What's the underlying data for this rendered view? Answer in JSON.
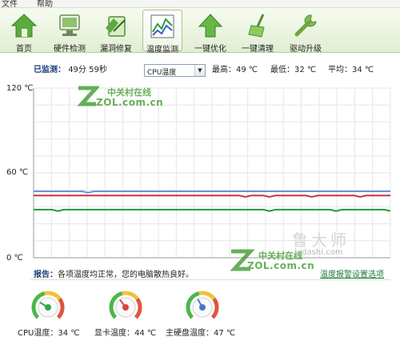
{
  "menu": {
    "file": "文件",
    "help": "帮助"
  },
  "toolbar": [
    {
      "label": "首页",
      "icon": "home-icon"
    },
    {
      "label": "硬件检测",
      "icon": "hardware-detect-icon"
    },
    {
      "label": "漏洞修复",
      "icon": "vulnerability-fix-icon"
    },
    {
      "label": "温度监测",
      "icon": "temperature-monitor-icon",
      "active": true
    },
    {
      "label": "一键优化",
      "icon": "optimize-arrow-icon"
    },
    {
      "label": "一键清理",
      "icon": "broom-icon"
    },
    {
      "label": "驱动升级",
      "icon": "wrench-icon"
    }
  ],
  "status": {
    "monitored_label": "已监测：",
    "monitored_value": "49分 59秒",
    "sensor_select": "CPU温度",
    "high_label": "最高：",
    "high_value": "49 ℃",
    "low_label": "最低：",
    "low_value": "32 ℃",
    "avg_label": "平均：",
    "avg_value": "34 ℃"
  },
  "chart_data": {
    "type": "line",
    "ylim": [
      0,
      120
    ],
    "yticks": [
      "120 ℃",
      "60 ℃",
      "0 ℃"
    ],
    "grid": true,
    "series": [
      {
        "color": "#6b8fe0",
        "values": [
          47,
          47,
          47,
          47,
          47,
          47,
          47,
          47,
          47,
          46,
          47,
          47,
          47,
          47,
          47,
          47,
          47,
          47,
          47,
          47,
          47,
          47,
          47,
          47,
          47,
          47,
          47,
          47,
          47,
          47,
          47,
          47,
          47,
          47,
          47,
          47,
          47,
          47,
          47,
          47,
          47,
          47,
          47,
          47,
          47,
          47,
          47,
          47,
          47,
          47,
          47,
          47,
          47,
          47,
          47,
          47,
          47,
          47,
          47,
          47
        ]
      },
      {
        "color": "#c4373f",
        "values": [
          44,
          44,
          44,
          44,
          44,
          44,
          44,
          44,
          44,
          44,
          44,
          44,
          44,
          44,
          44,
          44,
          44,
          44,
          44,
          44,
          44,
          44,
          44,
          44,
          44,
          44,
          44,
          44,
          44,
          44,
          44,
          44,
          44,
          44,
          44,
          43,
          44,
          44,
          44,
          43,
          44,
          44,
          44,
          44,
          44,
          44,
          43,
          44,
          44,
          44,
          44,
          44,
          44,
          44,
          43,
          44,
          44,
          44,
          44,
          44
        ]
      },
      {
        "color": "#1f9a3c",
        "values": [
          34,
          34,
          34,
          34,
          33,
          34,
          34,
          34,
          34,
          34,
          34,
          34,
          34,
          34,
          34,
          34,
          34,
          34,
          34,
          34,
          34,
          34,
          34,
          34,
          34,
          34,
          34,
          34,
          34,
          34,
          34,
          34,
          34,
          34,
          34,
          34,
          34,
          34,
          34,
          33,
          34,
          34,
          34,
          34,
          34,
          34,
          34,
          34,
          34,
          34,
          33,
          34,
          34,
          34,
          34,
          34,
          34,
          34,
          34,
          33
        ]
      }
    ]
  },
  "watermarks": {
    "zol_cn": "中关村在线",
    "zol_en": "ZOL.com.cn",
    "ludashi": "ludashi.com",
    "ludashi_big": "鲁大师"
  },
  "report": {
    "label": "报告：",
    "text": "各项温度均正常，您的电脑散热良好。",
    "alarm_link": "温度报警设置选项"
  },
  "gauges": [
    {
      "label": "CPU温度：",
      "value": "34 ℃",
      "level": 34,
      "color": "#2fa84a"
    },
    {
      "label": "显卡温度：",
      "value": "44 ℃",
      "level": 44,
      "color": "#d9443c"
    },
    {
      "label": "主硬盘温度：",
      "value": "47 ℃",
      "level": 47,
      "color": "#4a78c8"
    }
  ]
}
